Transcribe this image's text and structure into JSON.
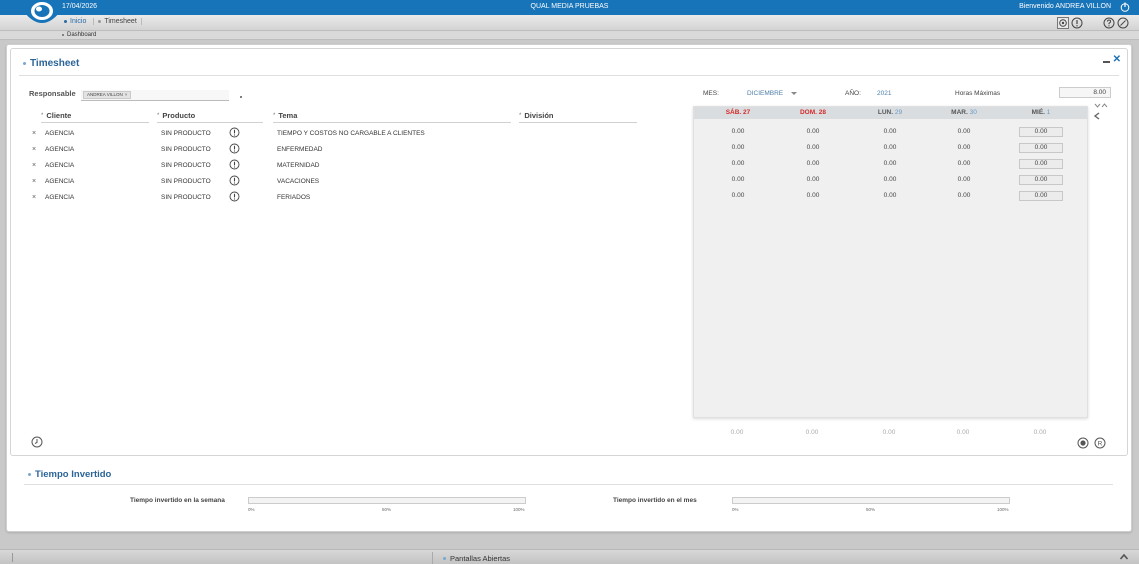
{
  "topbar": {
    "date": "17/04/2026",
    "app_title": "QUAL MEDIA PRUEBAS",
    "welcome": "Bienvenido ANDREA VILLON"
  },
  "nav": {
    "crumbs": [
      "Inicio",
      "Timesheet"
    ],
    "sub": "Dashboard"
  },
  "panel": {
    "title": "Timesheet"
  },
  "responsable": {
    "label": "Responsable",
    "tag": "ANDREA VILLON",
    "tag_close": "×"
  },
  "columns": {
    "cliente": "Cliente",
    "producto": "Producto",
    "tema": "Tema",
    "division": "División",
    "required_mark": "*"
  },
  "rows": [
    {
      "delete": "×",
      "cliente": "AGENCIA",
      "producto": "SIN PRODUCTO",
      "tema": "TIEMPO Y COSTOS NO CARGABLE A CLIENTES",
      "values": [
        "0.00",
        "0.00",
        "0.00",
        "0.00",
        "0.00"
      ]
    },
    {
      "delete": "×",
      "cliente": "AGENCIA",
      "producto": "SIN PRODUCTO",
      "tema": "ENFERMEDAD",
      "values": [
        "0.00",
        "0.00",
        "0.00",
        "0.00",
        "0.00"
      ]
    },
    {
      "delete": "×",
      "cliente": "AGENCIA",
      "producto": "SIN PRODUCTO",
      "tema": "MATERNIDAD",
      "values": [
        "0.00",
        "0.00",
        "0.00",
        "0.00",
        "0.00"
      ]
    },
    {
      "delete": "×",
      "cliente": "AGENCIA",
      "producto": "SIN PRODUCTO",
      "tema": "VACACIONES",
      "values": [
        "0.00",
        "0.00",
        "0.00",
        "0.00",
        "0.00"
      ]
    },
    {
      "delete": "×",
      "cliente": "AGENCIA",
      "producto": "SIN PRODUCTO",
      "tema": "FERIADOS",
      "values": [
        "0.00",
        "0.00",
        "0.00",
        "0.00",
        "0.00"
      ]
    }
  ],
  "period": {
    "mes_label": "MES:",
    "mes_value": "DICIEMBRE",
    "anio_label": "AÑO:",
    "anio_value": "2021",
    "horas_label": "Horas Máximas",
    "horas_value": "8.00"
  },
  "days": [
    {
      "name": "SÁB.",
      "num": "27",
      "weekend": true
    },
    {
      "name": "DOM.",
      "num": "28",
      "weekend": true
    },
    {
      "name": "LUN.",
      "num": "29",
      "weekend": false
    },
    {
      "name": "MAR.",
      "num": "30",
      "weekend": false
    },
    {
      "name": "MIÉ.",
      "num": "1",
      "weekend": false
    }
  ],
  "totals": [
    "0.00",
    "0.00",
    "0.00",
    "0.00",
    "0.00"
  ],
  "tiempo": {
    "title": "Tiempo Invertido",
    "semana_label": "Tiempo invertido en la semana",
    "mes_label": "Tiempo invertido en el mes",
    "semana_progress": 0,
    "mes_progress": 0,
    "ticks": [
      "0%",
      "50%",
      "100%"
    ]
  },
  "footer": {
    "label": "Pantallas Abiertas"
  },
  "colors": {
    "brand_blue": "#1874b8",
    "title_blue": "#2b6598",
    "weekend_red": "#d62a2a"
  }
}
